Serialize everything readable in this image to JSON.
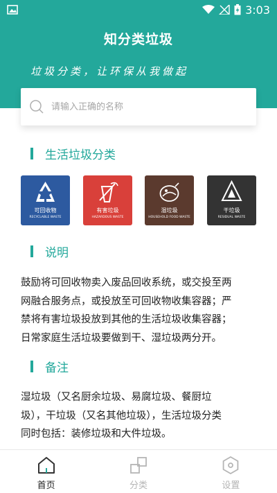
{
  "status_bar": {
    "time": "3:03"
  },
  "header": {
    "title": "知分类垃圾",
    "slogan": "垃圾分类，让环保从我做起"
  },
  "search": {
    "placeholder": "请输入正确的名称",
    "value": ""
  },
  "sections": {
    "living": "生活垃圾分类",
    "explain": "说明",
    "note": "备注"
  },
  "categories": [
    {
      "cn": "可回收物",
      "en": "RECYCLABLE WASTE",
      "color": "#2d5aa0",
      "icon": "recycle-icon"
    },
    {
      "cn": "有害垃圾",
      "en": "HAZARDOUS WASTE",
      "color": "#d9403a",
      "icon": "hazard-icon"
    },
    {
      "cn": "湿垃圾",
      "en": "HOUSEHOLD FOOD WASTE",
      "color": "#5b3a2e",
      "icon": "food-waste-icon"
    },
    {
      "cn": "干垃圾",
      "en": "RESIDUAL WASTE",
      "color": "#333333",
      "icon": "residual-icon"
    }
  ],
  "explain_lines": [
    "鼓励将可回收物卖入废品回收系统，或交投至两",
    "网融合服务点，或投放至可回收物收集容器；严",
    "禁将有害垃圾投放到其他的生活垃圾收集容器；",
    "日常家庭生活垃圾要做到干、湿垃圾两分开。"
  ],
  "note_lines": [
    "湿垃圾（又名厨余垃圾、易腐垃圾、餐厨垃",
    "圾），干垃圾（又名其他垃圾），生活垃圾分类",
    "同时包括：装修垃圾和大件垃圾。"
  ],
  "tabs": [
    {
      "label": "首页",
      "icon": "home-icon",
      "active": true
    },
    {
      "label": "分类",
      "icon": "category-icon",
      "active": false
    },
    {
      "label": "设置",
      "icon": "settings-icon",
      "active": false
    }
  ],
  "colors": {
    "accent": "#23a89b",
    "text": "#222222",
    "inactive": "#b5b5b5"
  }
}
